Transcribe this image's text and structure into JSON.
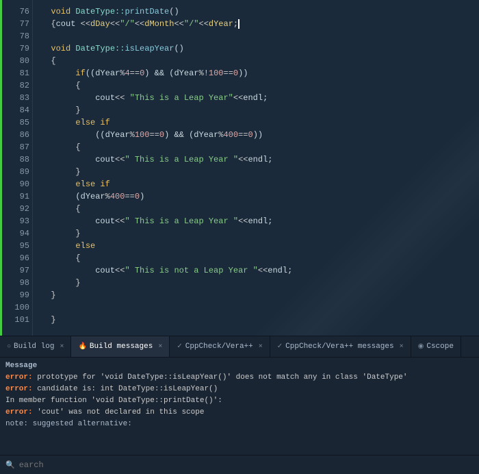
{
  "editor": {
    "lines": [
      {
        "num": "76",
        "content": [
          {
            "t": "  "
          },
          {
            "t": "void ",
            "c": "kw"
          },
          {
            "t": "DateType::",
            "c": "cls"
          },
          {
            "t": "printDate",
            "c": "fn"
          },
          {
            "t": "()"
          }
        ]
      },
      {
        "num": "77",
        "content": [
          {
            "t": "  "
          },
          {
            "t": "{",
            "c": "punc"
          },
          {
            "t": "cout ",
            "c": "ns"
          },
          {
            "t": "<<",
            "c": "op"
          },
          {
            "t": "dDay",
            "c": "var"
          },
          {
            "t": "<<",
            "c": "op"
          },
          {
            "t": "\"/\"",
            "c": "str"
          },
          {
            "t": "<<",
            "c": "op"
          },
          {
            "t": "dMonth",
            "c": "var"
          },
          {
            "t": "<<",
            "c": "op"
          },
          {
            "t": "\"/\"",
            "c": "str"
          },
          {
            "t": "<<",
            "c": "op"
          },
          {
            "t": "dYear",
            "c": "var"
          },
          {
            "t": ";",
            "c": "punc"
          },
          {
            "t": "█",
            "c": "cursor"
          }
        ]
      },
      {
        "num": "78",
        "content": []
      },
      {
        "num": "79",
        "content": [
          {
            "t": "  "
          },
          {
            "t": "void ",
            "c": "kw"
          },
          {
            "t": "DateType::",
            "c": "cls"
          },
          {
            "t": "isLeapYear",
            "c": "fn"
          },
          {
            "t": "()"
          }
        ]
      },
      {
        "num": "80",
        "content": [
          {
            "t": "  "
          },
          {
            "t": "{",
            "c": "punc"
          }
        ]
      },
      {
        "num": "81",
        "content": [
          {
            "t": "       "
          },
          {
            "t": "if",
            "c": "kw"
          },
          {
            "t": "((dYear",
            "c": "ns"
          },
          {
            "t": "%",
            "c": "op"
          },
          {
            "t": "4",
            "c": "num"
          },
          {
            "t": "==",
            "c": "op"
          },
          {
            "t": "0",
            "c": "num"
          },
          {
            "t": ") && (dYear",
            "c": "ns"
          },
          {
            "t": "%",
            "c": "op"
          },
          {
            "t": "!",
            "c": "op"
          },
          {
            "t": "100",
            "c": "num"
          },
          {
            "t": "==",
            "c": "op"
          },
          {
            "t": "0",
            "c": "num"
          },
          {
            "t": "))"
          }
        ]
      },
      {
        "num": "82",
        "content": [
          {
            "t": "       "
          },
          {
            "t": "{",
            "c": "punc"
          }
        ]
      },
      {
        "num": "83",
        "content": [
          {
            "t": "           "
          },
          {
            "t": "cout",
            "c": "ns"
          },
          {
            "t": "<< ",
            "c": "op"
          },
          {
            "t": "\"This is a Leap Year\"",
            "c": "str"
          },
          {
            "t": "<<",
            "c": "op"
          },
          {
            "t": "endl",
            "c": "ns"
          },
          {
            "t": ";"
          }
        ]
      },
      {
        "num": "84",
        "content": [
          {
            "t": "       "
          },
          {
            "t": "}",
            "c": "punc"
          }
        ]
      },
      {
        "num": "85",
        "content": [
          {
            "t": "       "
          },
          {
            "t": "else if",
            "c": "kw"
          }
        ]
      },
      {
        "num": "86",
        "content": [
          {
            "t": "           "
          },
          {
            "t": "((dYear",
            "c": "ns"
          },
          {
            "t": "%",
            "c": "op"
          },
          {
            "t": "100",
            "c": "num"
          },
          {
            "t": "==",
            "c": "op"
          },
          {
            "t": "0",
            "c": "num"
          },
          {
            "t": ") && (dYear",
            "c": "ns"
          },
          {
            "t": "%",
            "c": "op"
          },
          {
            "t": "400",
            "c": "num"
          },
          {
            "t": "==",
            "c": "op"
          },
          {
            "t": "0",
            "c": "num"
          },
          {
            "t": "))"
          }
        ]
      },
      {
        "num": "87",
        "content": [
          {
            "t": "       "
          },
          {
            "t": "{",
            "c": "punc"
          }
        ]
      },
      {
        "num": "88",
        "content": [
          {
            "t": "           "
          },
          {
            "t": "cout",
            "c": "ns"
          },
          {
            "t": "<<",
            "c": "op"
          },
          {
            "t": "\" This is a Leap Year \"",
            "c": "str"
          },
          {
            "t": "<<",
            "c": "op"
          },
          {
            "t": "endl",
            "c": "ns"
          },
          {
            "t": ";"
          }
        ]
      },
      {
        "num": "89",
        "content": [
          {
            "t": "       "
          },
          {
            "t": "}",
            "c": "punc"
          }
        ]
      },
      {
        "num": "90",
        "content": [
          {
            "t": "       "
          },
          {
            "t": "else if",
            "c": "kw"
          }
        ]
      },
      {
        "num": "91",
        "content": [
          {
            "t": "       "
          },
          {
            "t": "(dYear",
            "c": "ns"
          },
          {
            "t": "%",
            "c": "op"
          },
          {
            "t": "400",
            "c": "num"
          },
          {
            "t": "==",
            "c": "op"
          },
          {
            "t": "0",
            "c": "num"
          },
          {
            "t": ")"
          }
        ]
      },
      {
        "num": "92",
        "content": [
          {
            "t": "       "
          },
          {
            "t": "{",
            "c": "punc"
          }
        ]
      },
      {
        "num": "93",
        "content": [
          {
            "t": "           "
          },
          {
            "t": "cout",
            "c": "ns"
          },
          {
            "t": "<<",
            "c": "op"
          },
          {
            "t": "\" This is a Leap Year \"",
            "c": "str"
          },
          {
            "t": "<<",
            "c": "op"
          },
          {
            "t": "endl",
            "c": "ns"
          },
          {
            "t": ";"
          }
        ]
      },
      {
        "num": "94",
        "content": [
          {
            "t": "       "
          },
          {
            "t": "}",
            "c": "punc"
          }
        ]
      },
      {
        "num": "95",
        "content": [
          {
            "t": "       "
          },
          {
            "t": "else",
            "c": "kw"
          }
        ]
      },
      {
        "num": "96",
        "content": [
          {
            "t": "       "
          },
          {
            "t": "{",
            "c": "punc"
          }
        ]
      },
      {
        "num": "97",
        "content": [
          {
            "t": "           "
          },
          {
            "t": "cout",
            "c": "ns"
          },
          {
            "t": "<<",
            "c": "op"
          },
          {
            "t": "\" This is not a Leap Year \"",
            "c": "str"
          },
          {
            "t": "<<",
            "c": "op"
          },
          {
            "t": "endl",
            "c": "ns"
          },
          {
            "t": ";"
          }
        ]
      },
      {
        "num": "98",
        "content": [
          {
            "t": "       "
          },
          {
            "t": "}",
            "c": "punc"
          }
        ]
      },
      {
        "num": "99",
        "content": [
          {
            "t": "  "
          },
          {
            "t": "}",
            "c": "punc"
          }
        ]
      },
      {
        "num": "100",
        "content": []
      },
      {
        "num": "101",
        "content": [
          {
            "t": "  "
          },
          {
            "t": "}",
            "c": "punc"
          }
        ]
      }
    ]
  },
  "tabs": [
    {
      "label": "Build log",
      "icon": "circle",
      "active": false,
      "closable": true
    },
    {
      "label": "Build messages",
      "icon": "fire",
      "active": true,
      "closable": true
    },
    {
      "label": "CppCheck/Vera++",
      "icon": "check",
      "active": false,
      "closable": true
    },
    {
      "label": "CppCheck/Vera++ messages",
      "icon": "check",
      "active": false,
      "closable": true
    },
    {
      "label": "Cscope",
      "icon": "scope",
      "active": false,
      "closable": false
    }
  ],
  "messages": [
    {
      "type": "label",
      "text": "Message"
    },
    {
      "type": "error",
      "text": "error: prototype for 'void DateType::isLeapYear()' does not match any in class 'DateType'"
    },
    {
      "type": "error",
      "text": "error: candidate is: int DateType::isLeapYear()"
    },
    {
      "type": "normal",
      "text": "In member function 'void DateType::printDate()':"
    },
    {
      "type": "error",
      "text": "error: 'cout' was not declared in this scope"
    },
    {
      "type": "note",
      "text": "note: suggested alternative:"
    }
  ],
  "search": {
    "placeholder": "earch",
    "icon": "🔍"
  }
}
